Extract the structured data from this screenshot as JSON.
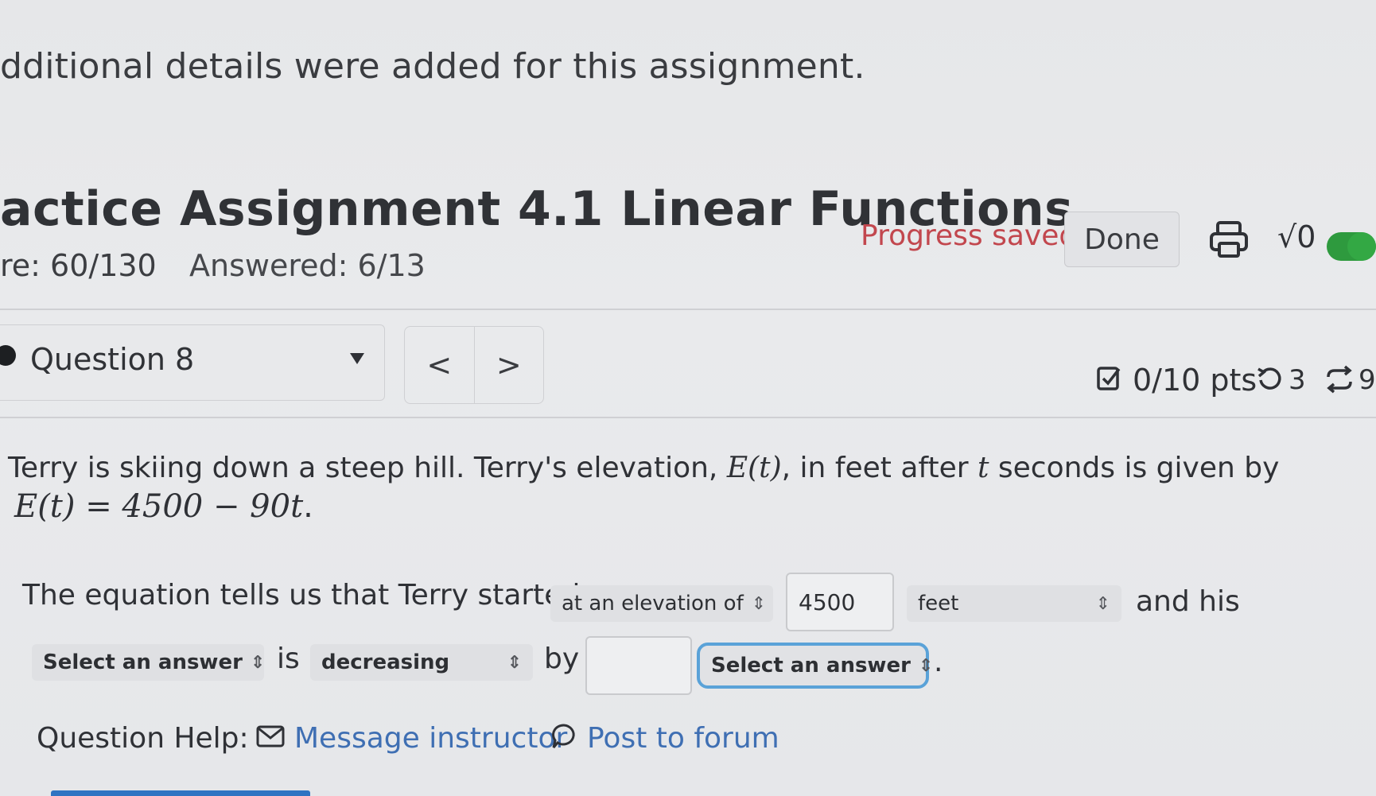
{
  "notice": "dditional details were added for this assignment.",
  "header": {
    "title": "actice Assignment 4.1 Linear Functions",
    "progress_status": "Progress saved",
    "done_label": "Done",
    "math_toggle_label": "√0",
    "score": "re: 60/130",
    "answered": "Answered: 6/13"
  },
  "question_nav": {
    "selected": "Question 8",
    "prev": "<",
    "next": ">",
    "points": "0/10 pts",
    "retries": "3",
    "submissions": "9"
  },
  "problem": {
    "line1_a": "Terry is skiing down a steep hill. Terry's elevation, ",
    "line1_math1": "E(t)",
    "line1_b": ", in feet after ",
    "line1_math2": "t",
    "line1_c": " seconds is given by",
    "equation": "E(t) = 4500 − 90t",
    "equation_end": "."
  },
  "answer": {
    "sentence_start": "The equation tells us that Terry started",
    "select_start": "at an elevation of",
    "start_value": "4500",
    "select_units": "feet",
    "and_his": "and his",
    "select_quantity": "Select an answer",
    "is_text": "is",
    "select_direction": "decreasing",
    "by_text": "by",
    "rate_value": "",
    "select_rate_units": "Select an answer",
    "period": "."
  },
  "help": {
    "label": "Question Help:",
    "message_link": "Message instructor",
    "forum_link": "Post to forum"
  },
  "colors": {
    "progress_red": "#c2474e",
    "toggle_green": "#2e9a3e",
    "link_blue": "#3f6fb3",
    "focus_blue": "#5aa2d8"
  },
  "icons": [
    "printer-icon",
    "checkbox-icon",
    "retry-icon",
    "submissions-icon",
    "mail-icon",
    "chat-bubble-icon",
    "chevron-updown-icon"
  ]
}
